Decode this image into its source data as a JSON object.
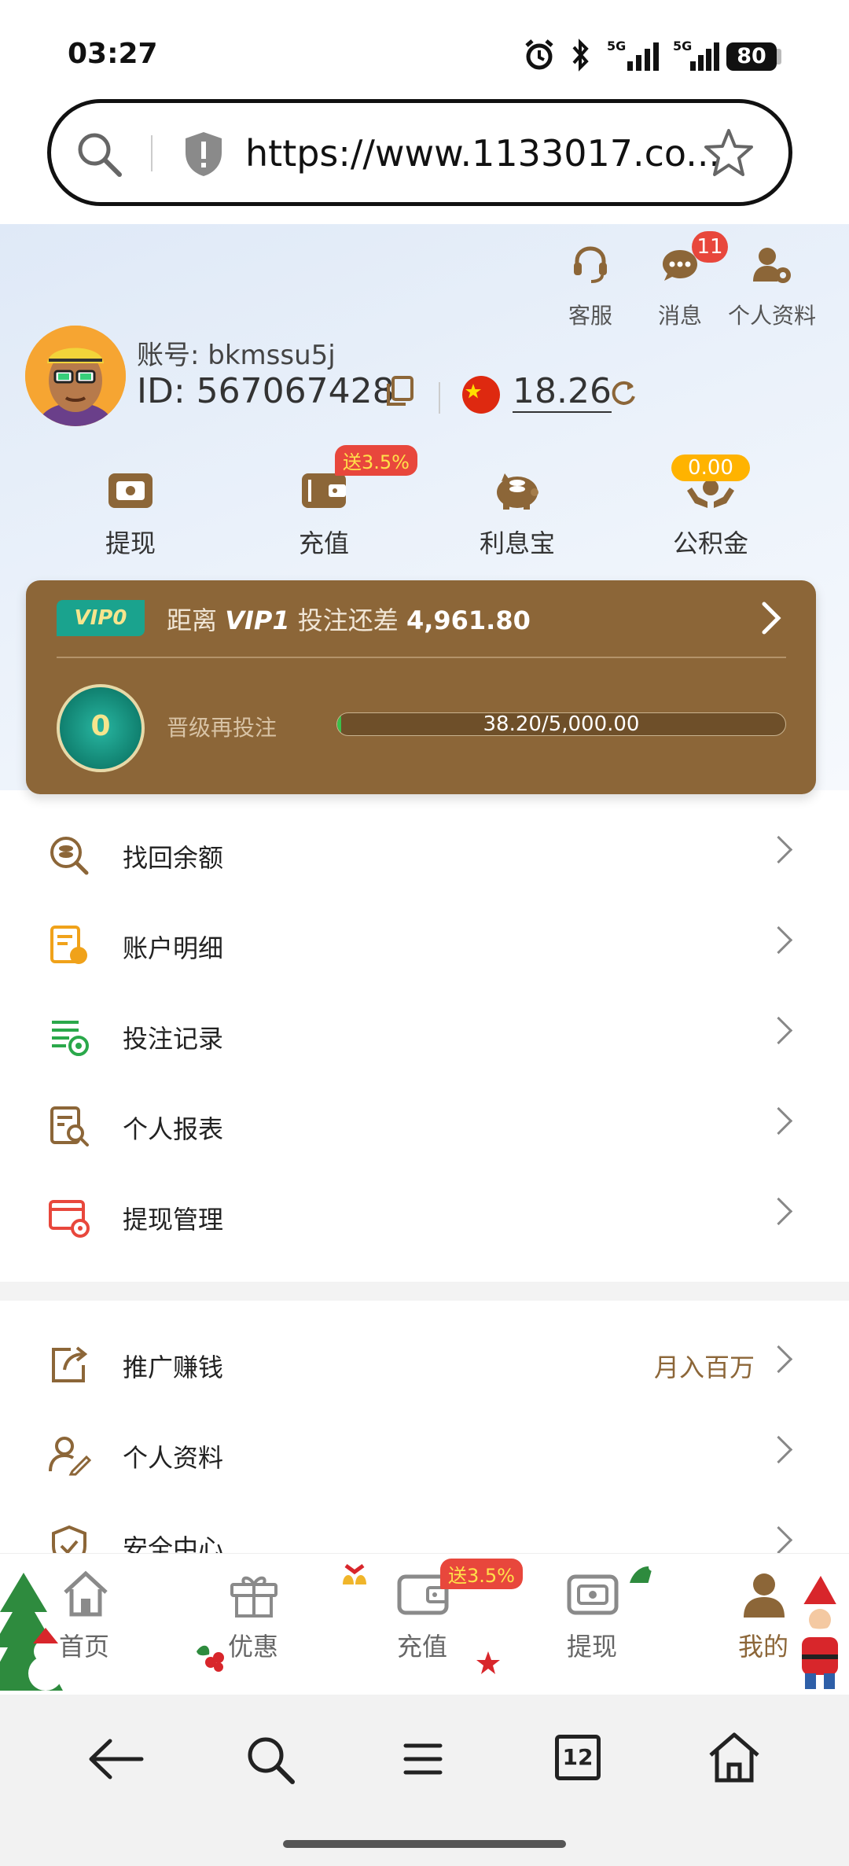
{
  "status_bar": {
    "time": "03:27",
    "battery": "80",
    "icons": [
      "alarm-icon",
      "bluetooth-icon",
      "signal-5g-icon",
      "signal-5g-icon"
    ]
  },
  "browser": {
    "url": "https://www.1133017.co...",
    "tab_count": "12"
  },
  "header": {
    "actions": [
      {
        "label": "客服",
        "icon": "headset-icon"
      },
      {
        "label": "消息",
        "icon": "chat-icon",
        "badge": "11"
      },
      {
        "label": "个人资料",
        "icon": "profile-settings-icon"
      }
    ],
    "account_label": "账号: bkmssu5j",
    "id_label": "ID: 567067428",
    "balance": "18.26"
  },
  "quick_actions": [
    {
      "label": "提现",
      "icon": "withdraw-icon"
    },
    {
      "label": "充值",
      "icon": "wallet-icon",
      "badge": "送3.5%"
    },
    {
      "label": "利息宝",
      "icon": "piggy-bank-icon"
    },
    {
      "label": "公积金",
      "icon": "hands-coin-icon",
      "badge": "0.00"
    }
  ],
  "vip": {
    "tag": "VIP0",
    "prefix": "距离 ",
    "next_level": "VIP1",
    "middle": " 投注还差 ",
    "remaining": "4,961.80",
    "medal_level": "0",
    "upgrade_label": "晋级再投注",
    "progress_text": "38.20/5,000.00",
    "progress_fraction": 0.00764
  },
  "menu_group1": [
    {
      "label": "找回余额",
      "icon": "search-coin-icon"
    },
    {
      "label": "账户明细",
      "icon": "account-detail-icon"
    },
    {
      "label": "投注记录",
      "icon": "bet-record-icon"
    },
    {
      "label": "个人报表",
      "icon": "report-icon"
    },
    {
      "label": "提现管理",
      "icon": "withdraw-manage-icon"
    }
  ],
  "menu_group2": [
    {
      "label": "推广赚钱",
      "icon": "share-icon",
      "extra": "月入百万"
    },
    {
      "label": "个人资料",
      "icon": "user-edit-icon"
    },
    {
      "label": "安全中心",
      "icon": "shield-check-icon"
    }
  ],
  "tabs": [
    {
      "label": "首页",
      "icon": "home-icon"
    },
    {
      "label": "优惠",
      "icon": "gift-icon"
    },
    {
      "label": "充值",
      "icon": "wallet-icon",
      "badge": "送3.5%"
    },
    {
      "label": "提现",
      "icon": "withdraw-icon"
    },
    {
      "label": "我的",
      "icon": "user-icon",
      "active": true
    }
  ],
  "colors": {
    "brand_brown": "#8c6638",
    "badge_red": "#e8473c",
    "vip_teal": "#1aa38e",
    "fund_yellow": "#ffb300"
  }
}
